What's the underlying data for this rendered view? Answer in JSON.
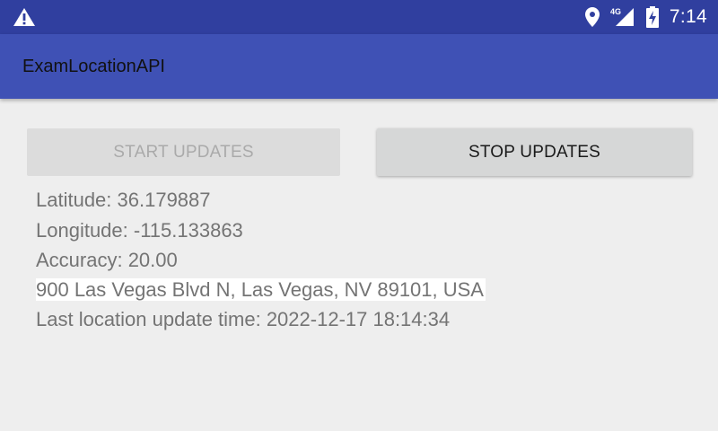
{
  "status_bar": {
    "left_icon": "warning-icon",
    "icons": [
      "location-pin-icon",
      "signal-4g-icon",
      "battery-charging-icon"
    ],
    "network_label": "4G",
    "time": "7:14"
  },
  "toolbar": {
    "title": "ExamLocationAPI"
  },
  "buttons": {
    "start": {
      "label": "START UPDATES",
      "enabled": false
    },
    "stop": {
      "label": "STOP UPDATES",
      "enabled": true
    }
  },
  "location": {
    "latitude": "Latitude: 36.179887",
    "longitude": "Longitude: -115.133863",
    "accuracy": "Accuracy: 20.00",
    "address": "900 Las Vegas Blvd N, Las Vegas, NV 89101, USA",
    "last_update": "Last location update time: 2022-12-17 18:14:34"
  },
  "colors": {
    "status_bar": "#303f9f",
    "toolbar": "#3f51b5",
    "background": "#eeeeee"
  }
}
